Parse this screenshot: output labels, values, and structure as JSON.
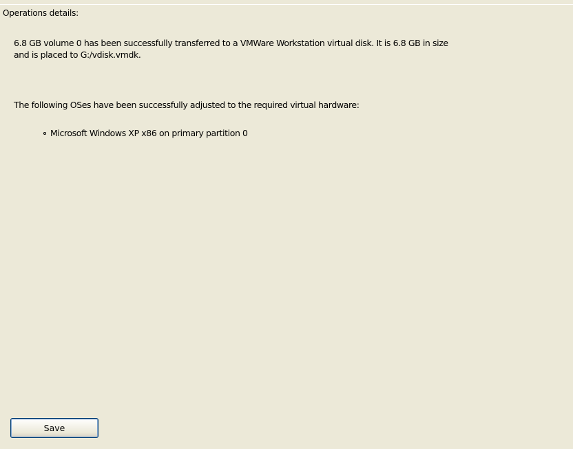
{
  "details": {
    "title": "Operations details:",
    "transfer_line1": "6.8 GB volume 0 has been successfully transferred to a VMWare Workstation virtual disk. It is 6.8 GB in size",
    "transfer_line2": "and is placed to G:/vdisk.vmdk.",
    "os_intro": "The following OSes have been successfully adjusted to the required virtual hardware:",
    "os_items": [
      "Microsoft Windows XP x86 on primary partition 0"
    ]
  },
  "actions": {
    "save_label": "Save"
  }
}
